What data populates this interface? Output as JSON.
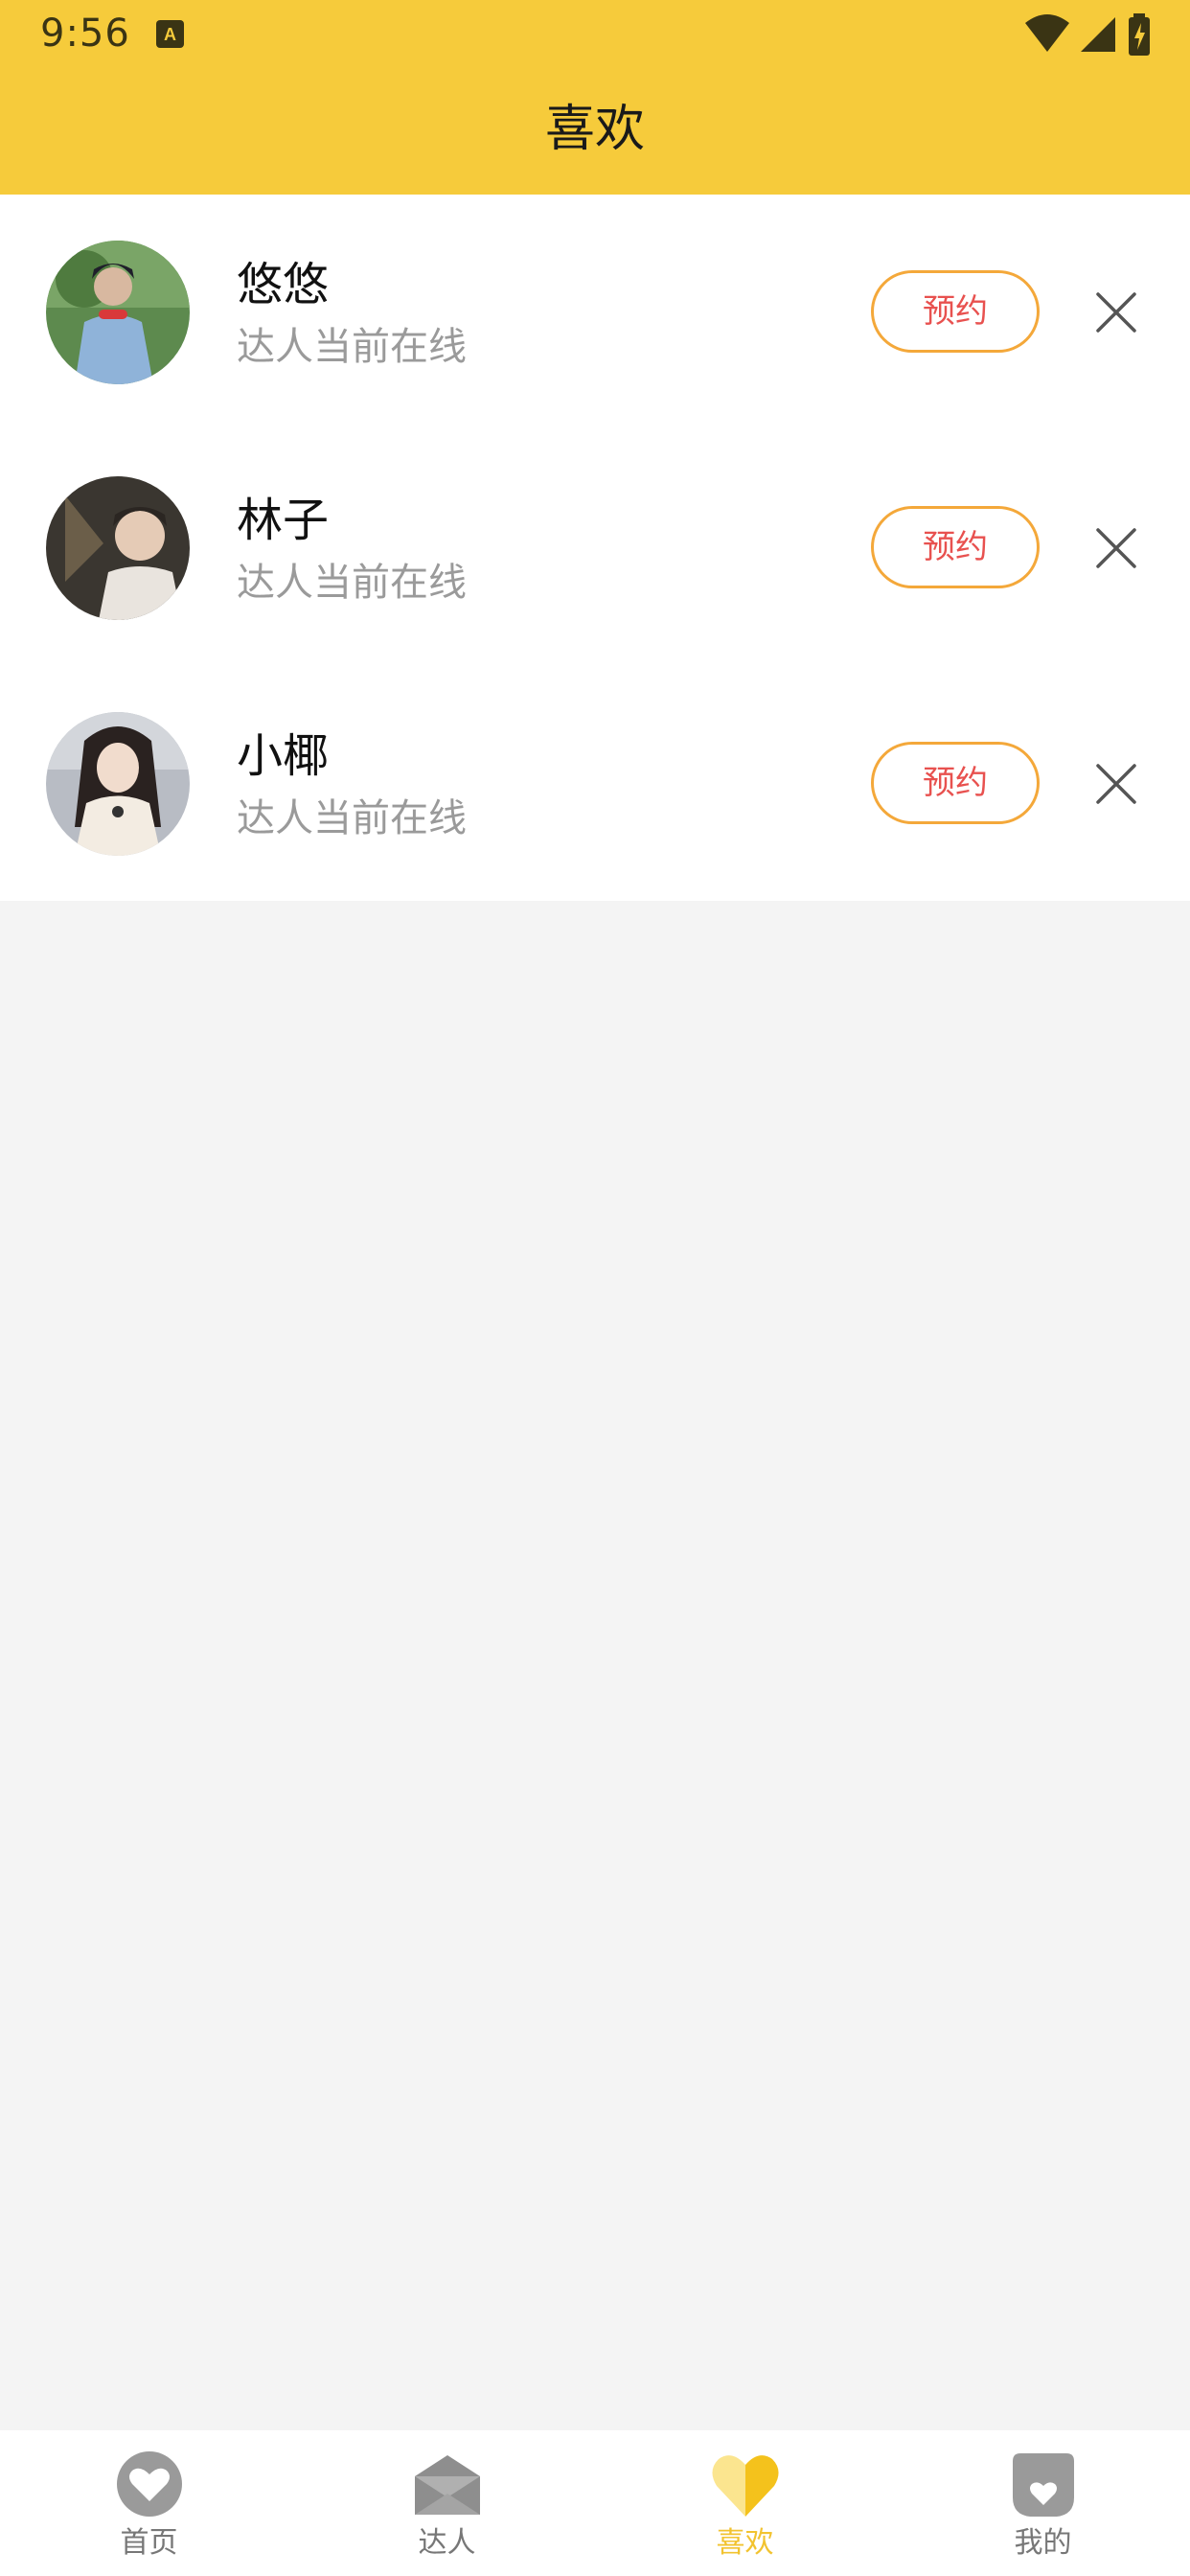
{
  "status_bar": {
    "time": "9:56",
    "icons": [
      "a-notification-icon",
      "wifi-icon",
      "signal-icon",
      "battery-charging-icon"
    ]
  },
  "header": {
    "title": "喜欢"
  },
  "list": {
    "items": [
      {
        "name": "悠悠",
        "status": "达人当前在线",
        "book_label": "预约"
      },
      {
        "name": "林子",
        "status": "达人当前在线",
        "book_label": "预约"
      },
      {
        "name": "小椰",
        "status": "达人当前在线",
        "book_label": "预约"
      }
    ]
  },
  "tabbar": {
    "tabs": [
      {
        "label": "首页",
        "icon": "heart-home-icon",
        "active": false
      },
      {
        "label": "达人",
        "icon": "envelope-icon",
        "active": false
      },
      {
        "label": "喜欢",
        "icon": "heart-like-icon",
        "active": true
      },
      {
        "label": "我的",
        "icon": "profile-heart-icon",
        "active": false
      }
    ]
  },
  "colors": {
    "header_bg": "#f6cb3b",
    "accent_orange": "#f4a83a",
    "book_text": "#e8514f",
    "tab_active": "#f2c330",
    "tab_inactive": "#777777",
    "page_bg": "#f4f4f4"
  }
}
